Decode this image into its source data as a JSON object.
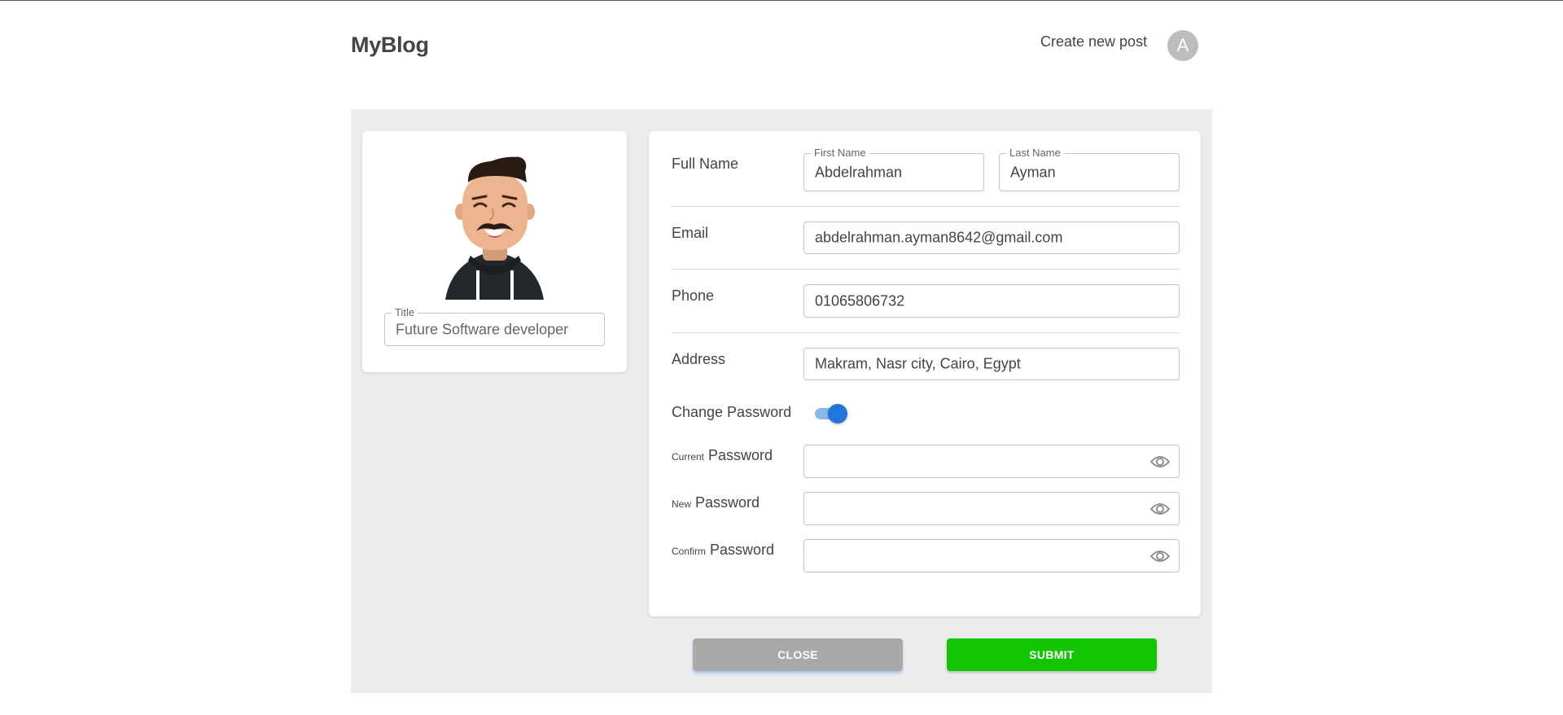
{
  "header": {
    "brand": "MyBlog",
    "create_post_label": "Create new post",
    "avatar_initial": "A"
  },
  "profile": {
    "title_label": "Title",
    "title_value": "Future Software developer"
  },
  "form": {
    "full_name_label": "Full Name",
    "first_name_label": "First Name",
    "first_name_value": "Abdelrahman",
    "last_name_label": "Last Name",
    "last_name_value": "Ayman",
    "email_label": "Email",
    "email_value": "abdelrahman.ayman8642@gmail.com",
    "phone_label": "Phone",
    "phone_value": "01065806732",
    "address_label": "Address",
    "address_value": "Makram, Nasr city, Cairo, Egypt",
    "change_password_label": "Change Password",
    "change_password_enabled": true,
    "current_prefix": "Current",
    "new_prefix": "New",
    "confirm_prefix": "Confirm",
    "password_word": "Password"
  },
  "actions": {
    "close_label": "CLOSE",
    "submit_label": "SUBMIT"
  },
  "colors": {
    "submit": "#13c400",
    "close": "#a9a9a9",
    "toggle_on": "#2176d9",
    "panel_bg": "#ececec"
  }
}
